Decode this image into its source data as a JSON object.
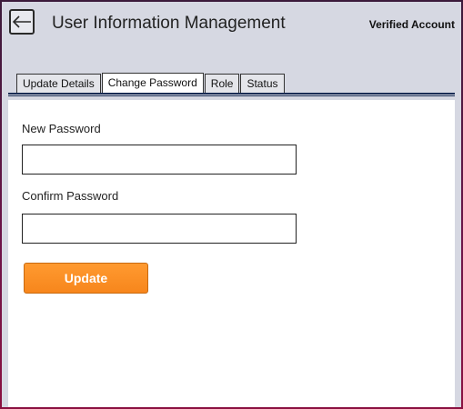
{
  "header": {
    "title": "User Information Management",
    "account_status": "Verified Account",
    "back_icon": "arrow-left-icon"
  },
  "tabs": [
    {
      "label": "Update Details",
      "active": false
    },
    {
      "label": "Change Password",
      "active": true
    },
    {
      "label": "Role",
      "active": false
    },
    {
      "label": "Status",
      "active": false
    }
  ],
  "form": {
    "new_password_label": "New Password",
    "new_password_value": "",
    "confirm_password_label": "Confirm Password",
    "confirm_password_value": "",
    "update_label": "Update"
  },
  "colors": {
    "accent": "#f7861c",
    "frame": "#6d1448",
    "background": "#d6d8e2"
  }
}
